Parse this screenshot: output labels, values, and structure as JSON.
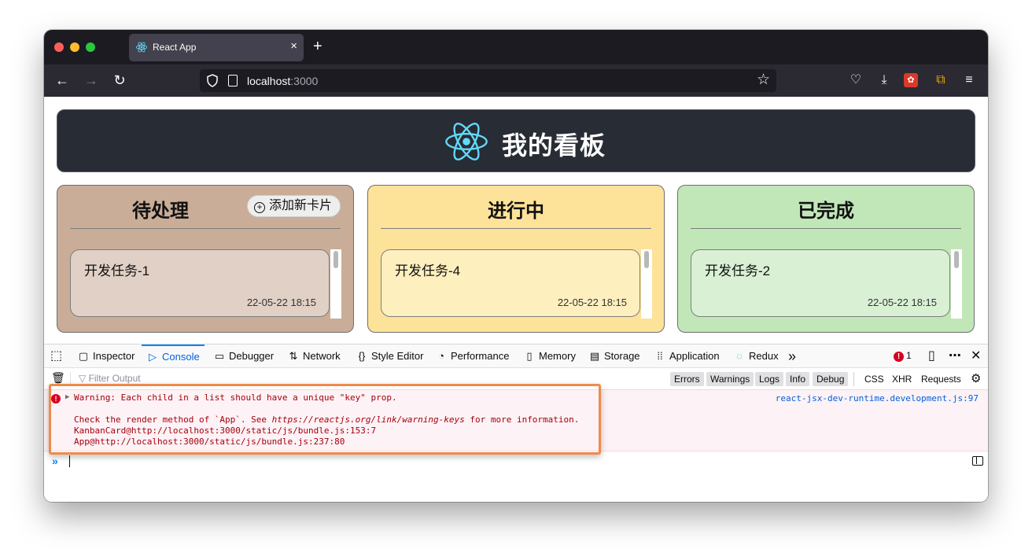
{
  "browser": {
    "tab_title": "React App",
    "tab_close": "×",
    "new_tab": "+",
    "url_host": "localhost",
    "url_port": ":3000"
  },
  "page": {
    "header_title": "我的看板",
    "columns": [
      {
        "title": "待处理",
        "add_button": "添加新卡片",
        "add_icon": "+",
        "card_title": "开发任务-1",
        "card_time": "22-05-22 18:15",
        "color": "#c9ad98"
      },
      {
        "title": "进行中",
        "card_title": "开发任务-4",
        "card_time": "22-05-22 18:15",
        "color": "#fde399"
      },
      {
        "title": "已完成",
        "card_title": "开发任务-2",
        "card_time": "22-05-22 18:15",
        "color": "#c1e7b9"
      }
    ]
  },
  "devtools": {
    "tabs": [
      "Inspector",
      "Console",
      "Debugger",
      "Network",
      "Style Editor",
      "Performance",
      "Memory",
      "Storage",
      "Application",
      "Redux"
    ],
    "active_tab": "Console",
    "error_count": "1",
    "filter_placeholder": "Filter Output",
    "level_buttons": [
      "Errors",
      "Warnings",
      "Logs",
      "Info",
      "Debug"
    ],
    "type_buttons": [
      "CSS",
      "XHR",
      "Requests"
    ],
    "message": {
      "line1": "Warning: Each child in a list should have a unique \"key\" prop.",
      "line2_before": "Check the render method of `App`. See ",
      "line2_link": "https://reactjs.org/link/warning-keys",
      "line2_after": " for more information.",
      "line3": "KanbanCard@http://localhost:3000/static/js/bundle.js:153:7",
      "line4": "App@http://localhost:3000/static/js/bundle.js:237:80",
      "source": "react-jsx-dev-runtime.development.js:97"
    },
    "prompt": "»"
  },
  "colors": {
    "header_bg": "#282c34",
    "react_blue": "#61dafb",
    "error_red": "#d70022",
    "highlight": "#f08a4b",
    "active_tab": "#0061e0"
  }
}
